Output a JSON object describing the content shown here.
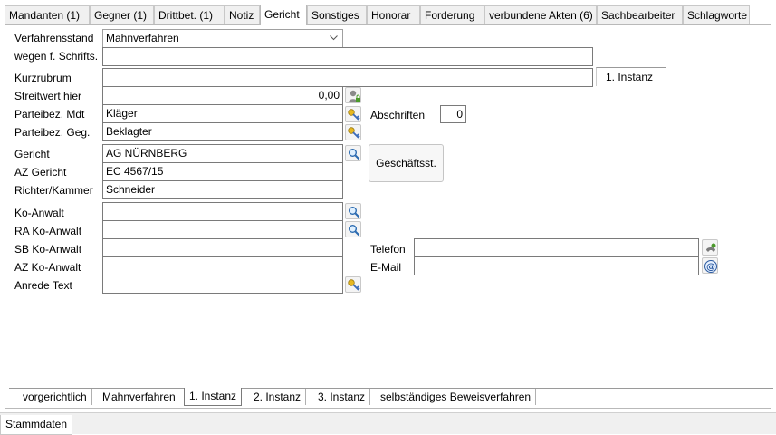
{
  "tabs": [
    {
      "label": "Mandanten (1)"
    },
    {
      "label": "Gegner (1)"
    },
    {
      "label": "Drittbet. (1)"
    },
    {
      "label": "Notiz"
    },
    {
      "label": "Gericht"
    },
    {
      "label": "Sonstiges"
    },
    {
      "label": "Honorar"
    },
    {
      "label": "Forderung"
    },
    {
      "label": "verbundene Akten (6)"
    },
    {
      "label": "Sachbearbeiter"
    },
    {
      "label": "Schlagworte"
    }
  ],
  "active_tab": "Gericht",
  "form": {
    "verfahrensstand": {
      "label": "Verfahrensstand",
      "value": "Mahnverfahren"
    },
    "wegen": {
      "label": "wegen f. Schrifts.",
      "value": ""
    },
    "kurzrubrum": {
      "label": "Kurzrubrum",
      "value": "",
      "badge": "1. Instanz"
    },
    "streitwert": {
      "label": "Streitwert hier",
      "value": "0,00"
    },
    "parteibez_mdt": {
      "label": "Parteibez. Mdt",
      "value": "Kläger"
    },
    "parteibez_geg": {
      "label": "Parteibez. Geg.",
      "value": "Beklagter"
    },
    "abschriften": {
      "label": "Abschriften",
      "value": "0"
    },
    "gericht": {
      "label": "Gericht",
      "value": "AG NÜRNBERG"
    },
    "az_gericht": {
      "label": "AZ Gericht",
      "value": "EC 4567/15"
    },
    "richter": {
      "label": "Richter/Kammer",
      "value": "Schneider"
    },
    "geschaeftsst_button": "Geschäftsst.",
    "ko_anwalt": {
      "label": "Ko-Anwalt",
      "value": ""
    },
    "ra_ko_anwalt": {
      "label": "RA Ko-Anwalt",
      "value": ""
    },
    "sb_ko_anwalt": {
      "label": "SB Ko-Anwalt",
      "value": ""
    },
    "az_ko_anwalt": {
      "label": "AZ Ko-Anwalt",
      "value": ""
    },
    "anrede_text": {
      "label": "Anrede Text",
      "value": ""
    },
    "telefon": {
      "label": "Telefon",
      "value": ""
    },
    "email": {
      "label": "E-Mail",
      "value": ""
    }
  },
  "bottom_tabs": [
    {
      "label": "vorgerichtlich"
    },
    {
      "label": "Mahnverfahren"
    },
    {
      "label": "1. Instanz"
    },
    {
      "label": "2. Instanz"
    },
    {
      "label": "3. Instanz"
    },
    {
      "label": "selbständiges Beweisverfahren"
    }
  ],
  "active_bottom_tab": "1. Instanz",
  "status": {
    "label": "Stammdaten"
  },
  "icons": {
    "user_lock": "user-lock-icon",
    "key": "key-icon",
    "search": "search-icon",
    "phone": "phone-icon",
    "email": "at-icon",
    "dropdown": "chevron-down-icon"
  }
}
